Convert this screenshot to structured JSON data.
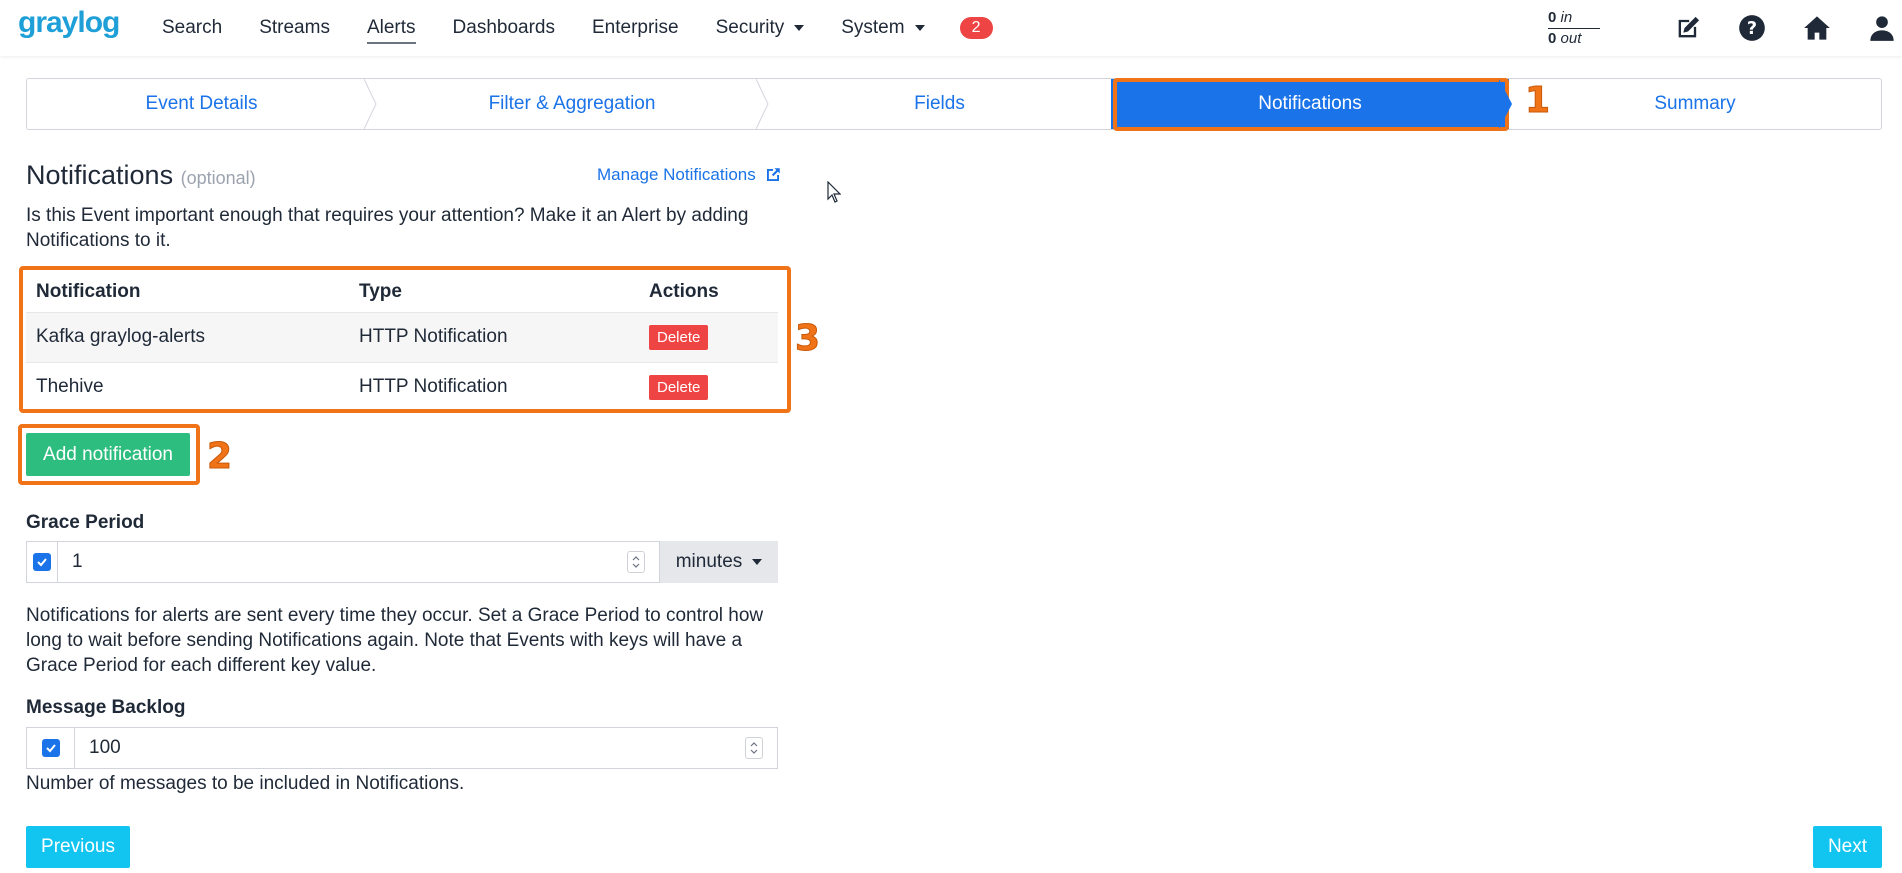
{
  "nav": {
    "logo": "graylog",
    "items": [
      "Search",
      "Streams",
      "Alerts",
      "Dashboards",
      "Enterprise",
      "Security",
      "System"
    ],
    "badge": "2",
    "throughput": {
      "in_count": "0",
      "in_label": "in",
      "out_count": "0",
      "out_label": "out"
    },
    "icons": [
      "edit-icon",
      "help-icon",
      "home-icon",
      "user-icon"
    ]
  },
  "wizard": {
    "steps": [
      "Event Details",
      "Filter & Aggregation",
      "Fields",
      "Notifications",
      "Summary"
    ],
    "active_step": "Notifications"
  },
  "annotations": {
    "one": "1",
    "two": "2",
    "three": "3",
    "color": "#f07318"
  },
  "notifications": {
    "title": "Notifications",
    "optional": "(optional)",
    "manage_link": "Manage Notifications",
    "description": "Is this Event important enough that requires your attention? Make it an Alert by adding Notifications to it.",
    "table": {
      "headers": [
        "Notification",
        "Type",
        "Actions"
      ],
      "rows": [
        {
          "name": "Kafka graylog-alerts",
          "type": "HTTP Notification",
          "action": "Delete"
        },
        {
          "name": "Thehive",
          "type": "HTTP Notification",
          "action": "Delete"
        }
      ]
    },
    "add_button": "Add notification"
  },
  "grace_period": {
    "label": "Grace Period",
    "enabled": true,
    "value": "1",
    "unit": "minutes",
    "help": "Notifications for alerts are sent every time they occur. Set a Grace Period to control how long to wait before sending Notifications again. Note that Events with keys will have a Grace Period for each different key value."
  },
  "message_backlog": {
    "label": "Message Backlog",
    "enabled": true,
    "value": "100",
    "help": "Number of messages to be included in Notifications."
  },
  "footer": {
    "previous": "Previous",
    "next": "Next"
  },
  "colors": {
    "primary": "#1a73e8",
    "success": "#2dbd7e",
    "danger": "#ef4444",
    "info": "#11c5f0",
    "highlight": "#f07318"
  }
}
